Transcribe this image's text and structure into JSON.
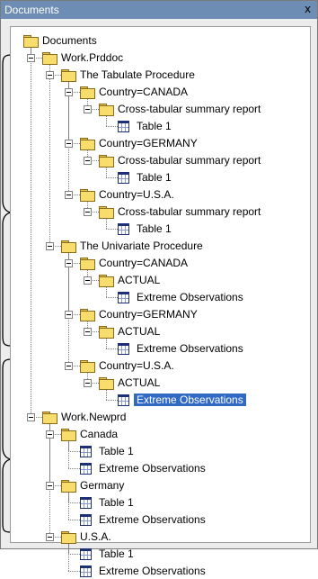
{
  "window": {
    "title": "Documents",
    "close_glyph": "x"
  },
  "tree": {
    "nodes": [
      {
        "label": "Documents",
        "icon": "folder-icon"
      },
      {
        "label": "Work.Prddoc",
        "icon": "folder-icon"
      },
      {
        "label": "The Tabulate Procedure",
        "icon": "folder-icon"
      },
      {
        "label": "Country=CANADA",
        "icon": "folder-icon"
      },
      {
        "label": "Cross-tabular summary report",
        "icon": "folder-icon"
      },
      {
        "label": "Table 1",
        "icon": "table-icon"
      },
      {
        "label": "Country=GERMANY",
        "icon": "folder-icon"
      },
      {
        "label": "Cross-tabular summary report",
        "icon": "folder-icon"
      },
      {
        "label": "Table 1",
        "icon": "table-icon"
      },
      {
        "label": "Country=U.S.A.",
        "icon": "folder-icon"
      },
      {
        "label": "Cross-tabular summary report",
        "icon": "folder-icon"
      },
      {
        "label": "Table 1",
        "icon": "table-icon"
      },
      {
        "label": "The Univariate Procedure",
        "icon": "folder-icon"
      },
      {
        "label": "Country=CANADA",
        "icon": "folder-icon"
      },
      {
        "label": "ACTUAL",
        "icon": "folder-icon"
      },
      {
        "label": "Extreme Observations",
        "icon": "table-icon"
      },
      {
        "label": "Country=GERMANY",
        "icon": "folder-icon"
      },
      {
        "label": "ACTUAL",
        "icon": "folder-icon"
      },
      {
        "label": "Extreme Observations",
        "icon": "table-icon"
      },
      {
        "label": "Country=U.S.A.",
        "icon": "folder-icon"
      },
      {
        "label": "ACTUAL",
        "icon": "folder-icon"
      },
      {
        "label": "Extreme Observations",
        "icon": "table-icon",
        "selected": true
      },
      {
        "label": "Work.Newprd",
        "icon": "folder-icon"
      },
      {
        "label": "Canada",
        "icon": "folder-icon"
      },
      {
        "label": "Table 1",
        "icon": "table-icon"
      },
      {
        "label": "Extreme Observations",
        "icon": "table-icon"
      },
      {
        "label": "Germany",
        "icon": "folder-icon"
      },
      {
        "label": "Table 1",
        "icon": "table-icon"
      },
      {
        "label": "Extreme Observations",
        "icon": "table-icon"
      },
      {
        "label": "U.S.A.",
        "icon": "folder-icon"
      },
      {
        "label": "Table 1",
        "icon": "table-icon"
      },
      {
        "label": "Extreme Observations",
        "icon": "table-icon"
      }
    ]
  },
  "colors": {
    "titlebar": "#6e8db4",
    "selection": "#316ac5",
    "folder": "#f8dc6c",
    "table_icon": "#1e2f7a"
  }
}
